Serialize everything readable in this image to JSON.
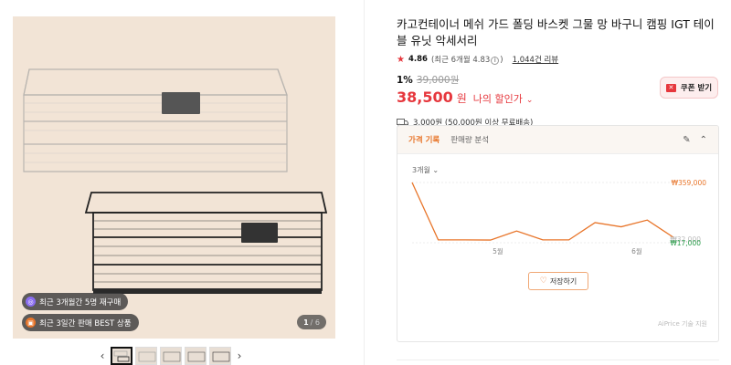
{
  "gallery": {
    "badges": [
      {
        "icon": "repurchase-icon",
        "text": "최근 3개월간 5명 재구매",
        "color": "#8a6df0"
      },
      {
        "icon": "gift-icon",
        "text": "최근 3일간 판매 BEST 상품",
        "color": "#e8752a"
      }
    ],
    "counter_current": "1",
    "counter_total": "/ 6",
    "thumbnail_count": 5
  },
  "product": {
    "title": "카고컨테이너 메쉬 가드 폴딩 바스켓 그물 망 바구니 캠핑 IGT 테이블 유닛 악세서리",
    "rating": "4.86",
    "rating_recent": "(최근 6개월 4.83",
    "rating_info_icon": "info-icon",
    "rating_close": ")",
    "reviews": "1,044건 리뷰",
    "discount_pct": "1%",
    "original_price": "39,000원",
    "price": "38,500",
    "price_unit": "원",
    "my_price_label": "나의 할인가",
    "coupon_label": "쿠폰 받기",
    "shipping": "3,000원 (50,000원 이상 무료배송)"
  },
  "price_history": {
    "tab_active": "가격 기록",
    "tab_other": "판매량 분석",
    "period": "3개월",
    "save_label": "저장하기",
    "credit": "AiPrice 기술 지원",
    "max_label": "₩359,000",
    "min_label": "₩17,000",
    "current_label": "₩32,000",
    "x_labels": [
      "5월",
      "6월"
    ],
    "accent": "#e8752a",
    "min_color": "#2a9d4a"
  },
  "chart_data": {
    "type": "line",
    "title": "",
    "xlabel": "",
    "ylabel": "",
    "x_tick_labels": [
      "5월",
      "6월"
    ],
    "series": [
      {
        "values": [
          359000,
          17000,
          17000,
          16000,
          70000,
          17000,
          17000,
          120000,
          95000,
          135000,
          32000
        ]
      }
    ],
    "y_labels": {
      "max": "₩359,000",
      "current": "₩32,000",
      "min": "₩17,000"
    }
  }
}
